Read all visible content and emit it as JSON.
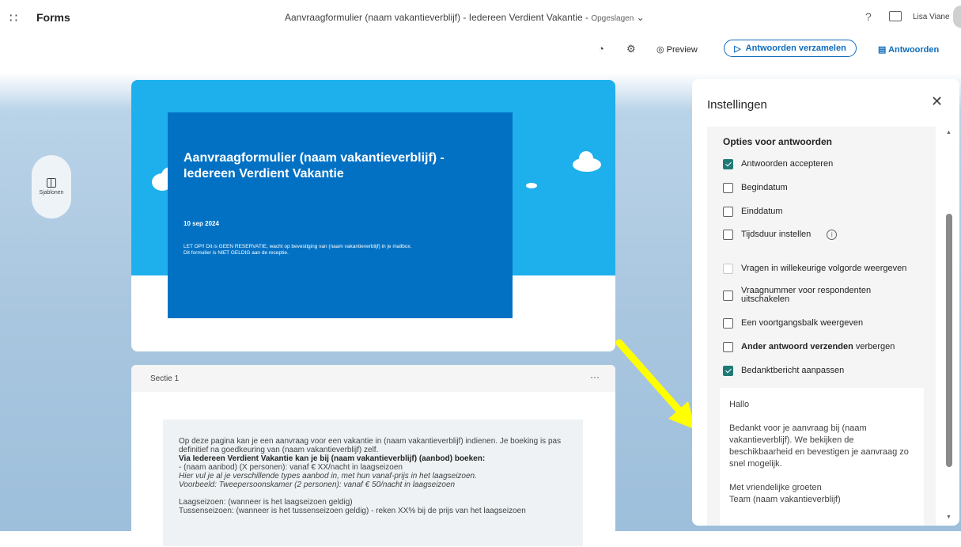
{
  "app": {
    "name": "Forms",
    "waffle_glyph": "∷"
  },
  "header": {
    "doc_title": "Aanvraagformulier (naam vakantieverblijf) - Iedereen Verdient Vakantie",
    "separator": "-",
    "saved_status": "Opgeslagen",
    "help_glyph": "?",
    "user_name": "Lisa Viane"
  },
  "toolbar": {
    "theme_glyph": "◔",
    "settings_glyph": "⚙",
    "preview_label": "Preview",
    "collect_label": "Antwoorden verzamelen",
    "answers_label": "Antwoorden"
  },
  "sidebar": {
    "templates_label": "Sjablonen"
  },
  "form": {
    "title": "Aanvraagformulier (naam vakantieverblijf) - Iedereen Verdient Vakantie",
    "date": "10 sep 2024",
    "notice_line1": "LET OP!! Dit is GEEN RESERVATIE, wacht op bevestiging van (naam vakantieverblijf) in je mailbox.",
    "notice_line2": "Dit formulier is NIET GELDIG aan de receptie."
  },
  "section": {
    "label": "Sectie 1",
    "more_glyph": "···",
    "lines": {
      "l1": "Op deze pagina kan je een aanvraag voor een vakantie in (naam vakantieverblijf) indienen. Je boeking is pas definitief na goedkeuring van (naam vakantieverblijf) zelf.",
      "l2": "Via Iedereen Verdient Vakantie kan je bij (naam vakantieverblijf) (aanbod) boeken:",
      "l3": "- (naam aanbod) (X personen): vanaf € XX/nacht in laagseizoen",
      "l4": "Hier vul je al je verschillende types aanbod in, met hun vanaf-prijs in het laagseizoen.",
      "l5": "Voorbeeld: Tweepersoonskamer (2 personen): vanaf € 50/nacht in laagseizoen",
      "l6": "Laagseizoen: (wanneer is het laagseizoen geldig)",
      "l7": "Tussenseizoen: (wanneer is het tussenseizoen geldig) - reken XX% bij de prijs van het laagseizoen"
    }
  },
  "settings": {
    "title": "Instellingen",
    "close_glyph": "✕",
    "section_heading": "Opties voor antwoorden",
    "options": {
      "accept": {
        "label": "Antwoorden accepteren",
        "checked": true
      },
      "start": {
        "label": "Begindatum",
        "checked": false
      },
      "end": {
        "label": "Einddatum",
        "checked": false
      },
      "duration": {
        "label": "Tijdsduur instellen",
        "checked": false
      },
      "shuffle": {
        "label": "Vragen in willekeurige volgorde weergeven",
        "checked": false
      },
      "numbers": {
        "label": "Vraagnummer voor respondenten uitschakelen",
        "checked": false
      },
      "progress": {
        "label": "Een voortgangsbalk weergeven",
        "checked": false
      },
      "other_bold": "Ander antwoord verzenden",
      "other_rest": " verbergen",
      "thanks": {
        "label": "Bedanktbericht aanpassen",
        "checked": true
      }
    },
    "thanks_message": {
      "p1": "Hallo",
      "p2": "Bedankt voor je aanvraag bij (naam vakantieverblijf). We bekijken de beschikbaarheid en bevestigen je aanvraag zo snel mogelijk.",
      "p3a": "Met vriendelijke groeten",
      "p3b": "Team (naam vakantieverblijf)"
    }
  },
  "colors": {
    "accent": "#0f6cbd",
    "header_blue": "#0271c4",
    "sky": "#1db0ec",
    "check": "#1f7a76",
    "arrow": "#ffff00"
  }
}
